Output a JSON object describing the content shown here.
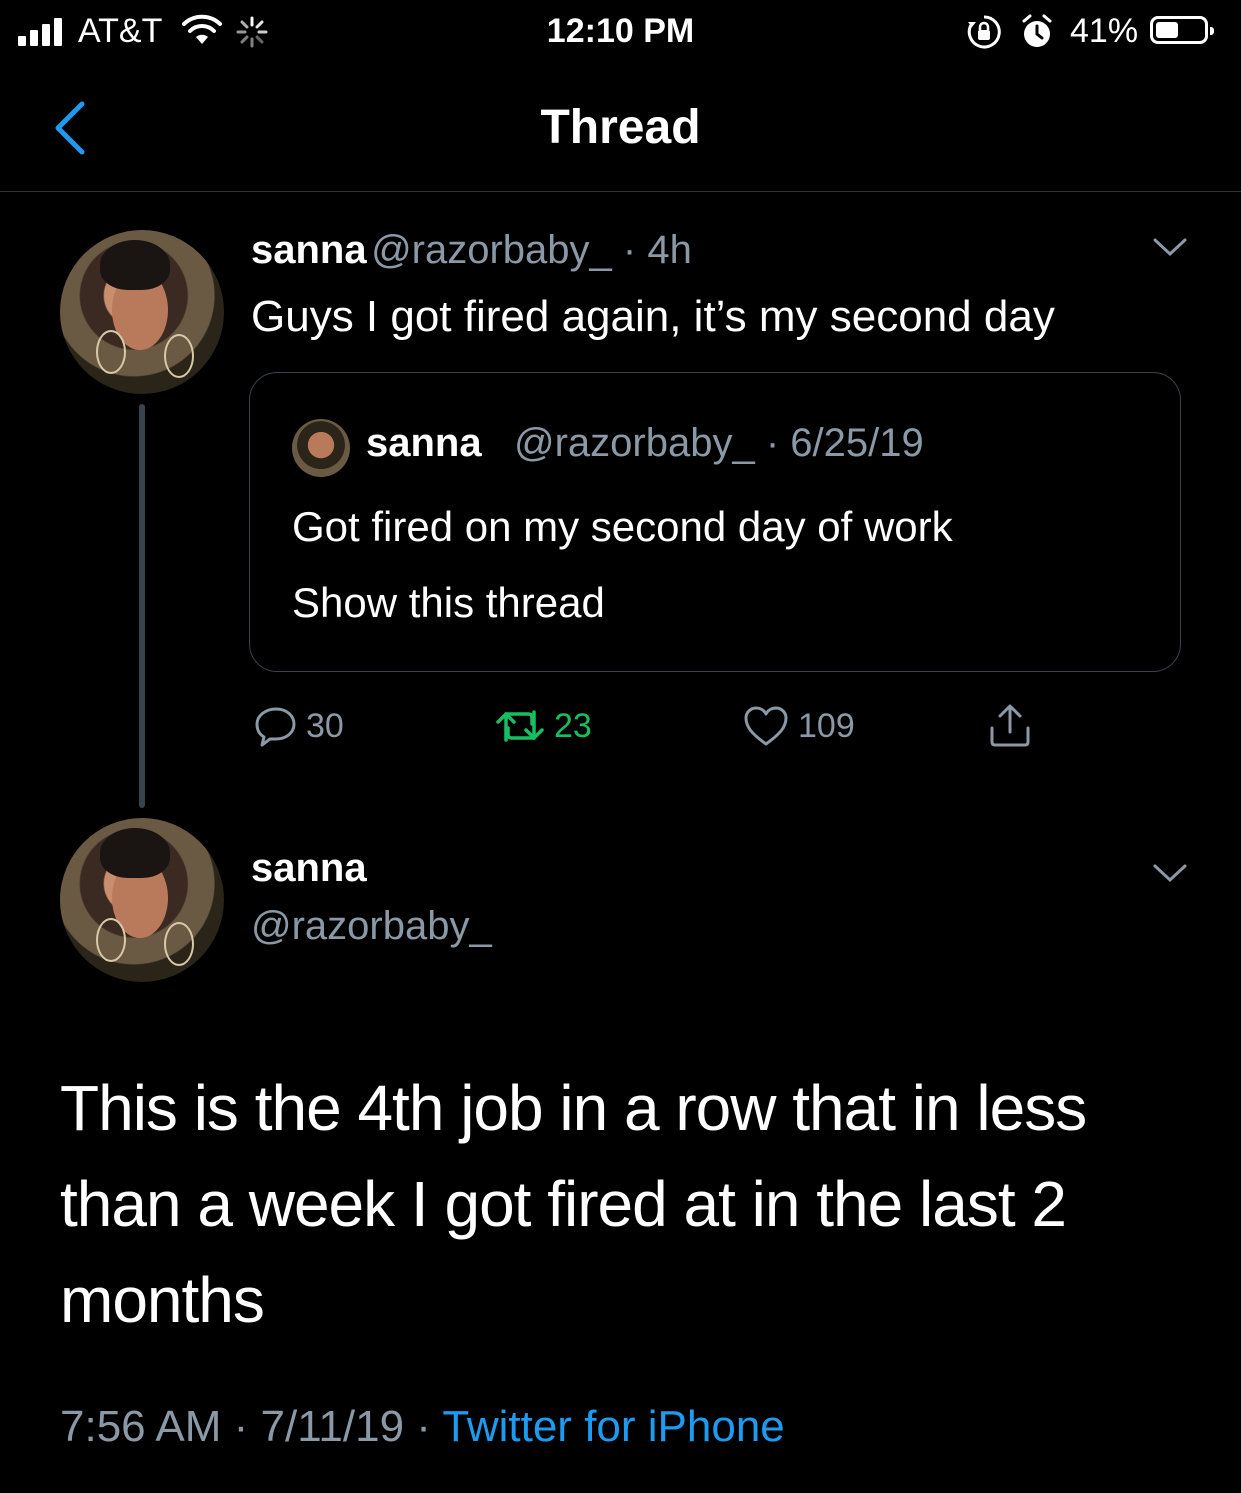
{
  "status_bar": {
    "carrier": "AT&T",
    "time": "12:10 PM",
    "battery_percent": "41%",
    "battery_level": 0.41
  },
  "nav": {
    "title": "Thread"
  },
  "tweet1": {
    "display_name": "sanna",
    "handle_time": "@razorbaby_ · 4h",
    "text": "Guys I got fired again, it’s my second day",
    "quote": {
      "display_name": "sanna",
      "handle_date": "@razorbaby_ · 6/25/19",
      "text": "Got fired on my second day of work",
      "show_thread": "Show this thread"
    },
    "replies": "30",
    "retweets": "23",
    "likes": "109"
  },
  "tweet2": {
    "display_name": "sanna",
    "handle": "@razorbaby_",
    "text": "This is the 4th job in a row that in less than a week I got fired at in the last 2 months",
    "timestamp": "7:56 AM · 7/11/19 · ",
    "source": "Twitter for iPhone"
  },
  "colors": {
    "background": "#000000",
    "secondary_text": "#8b98a5",
    "link": "#1d9bf0",
    "retweet_green": "#17bf63",
    "border": "#38444d"
  }
}
